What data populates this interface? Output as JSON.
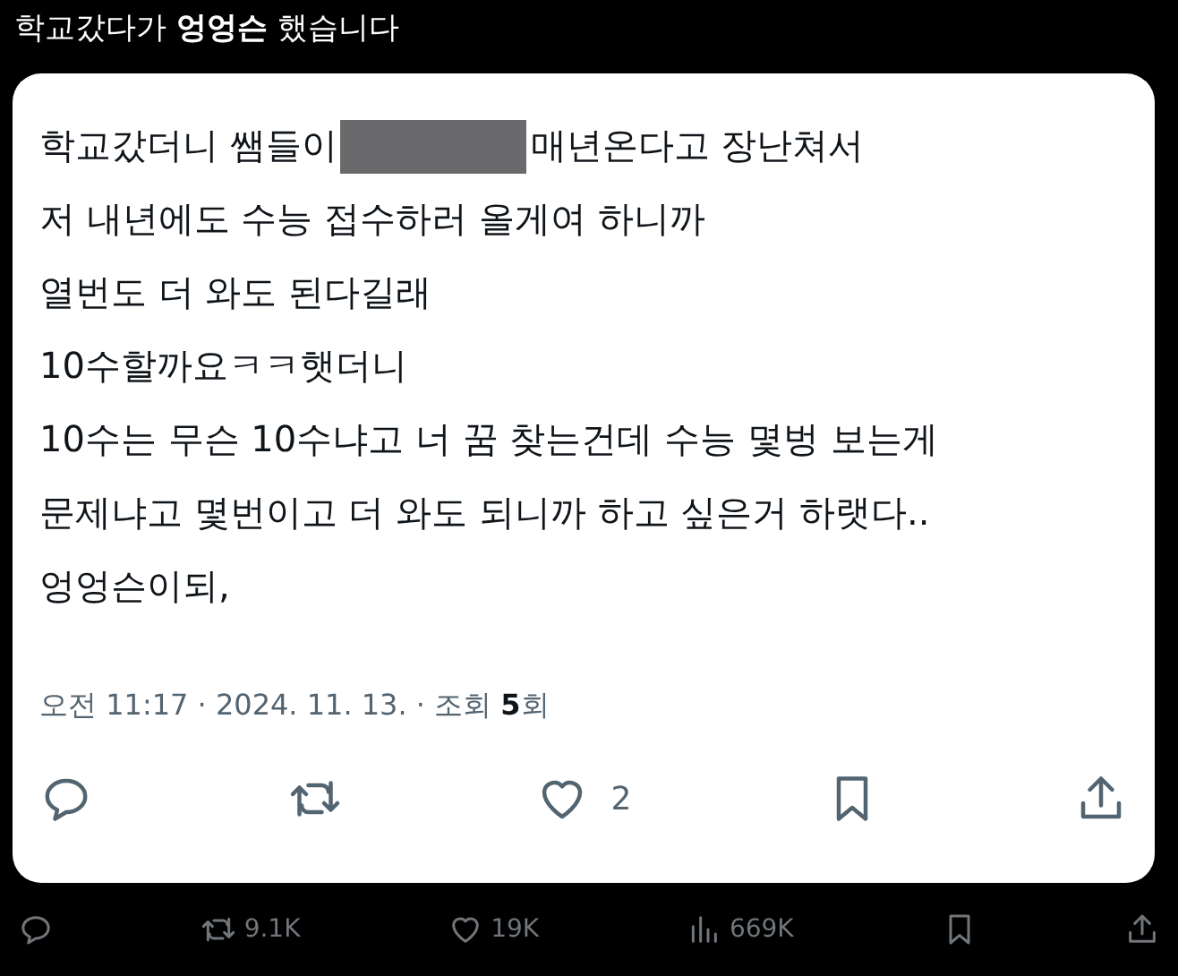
{
  "title": "학교갔다가 **엉엉슨** 했습니다",
  "post": {
    "lines": [
      {
        "segments": [
          {
            "kind": "text",
            "text": "학교갔더니 쌤들이"
          },
          {
            "kind": "redaction"
          },
          {
            "kind": "text",
            "text": "매년온다고 장난쳐서"
          }
        ]
      },
      {
        "segments": [
          {
            "kind": "text",
            "text": "저 내년에도 수능 접수하러 올게여 하니까"
          }
        ]
      },
      {
        "segments": [
          {
            "kind": "text",
            "text": "열번도 더 와도 된다길래"
          }
        ]
      },
      {
        "segments": [
          {
            "kind": "text",
            "text": "10수할까요ㅋㅋ햇더니"
          }
        ]
      },
      {
        "segments": [
          {
            "kind": "text",
            "text": "10수는 무슨 10수냐고 너 꿈 찾는건데 수능 몇벙 보는게"
          }
        ]
      },
      {
        "segments": [
          {
            "kind": "text",
            "text": "문제냐고 몇번이고 더 와도 되니까 하고 싶은거 하랫다.."
          }
        ]
      },
      {
        "segments": [
          {
            "kind": "text",
            "text": "엉엉슨이되,"
          }
        ]
      }
    ],
    "meta": "오전 11:17 · 2024. 11. 13. · 조회 **5**회",
    "actions": [
      {
        "kind": "reply"
      },
      {
        "kind": "retweet"
      },
      {
        "kind": "like",
        "count": "2"
      },
      {
        "kind": "bookmark"
      },
      {
        "kind": "share"
      }
    ]
  },
  "bottom_bar": [
    {
      "kind": "reply"
    },
    {
      "kind": "retweet",
      "count": "9.1K"
    },
    {
      "kind": "like",
      "count": "19K"
    },
    {
      "kind": "views",
      "count": "669K"
    },
    {
      "kind": "bookmark"
    },
    {
      "kind": "share"
    }
  ]
}
